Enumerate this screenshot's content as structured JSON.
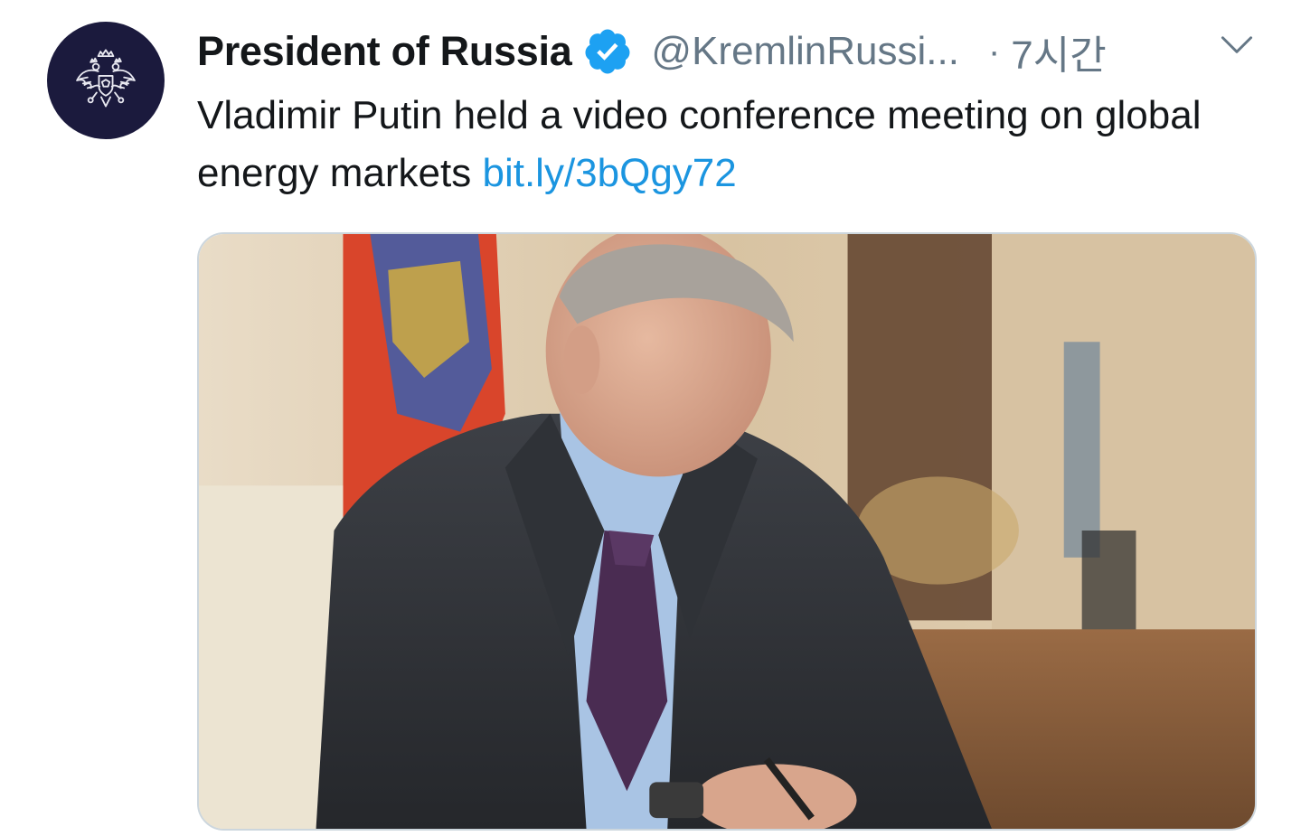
{
  "tweet": {
    "display_name": "President of Russia",
    "handle": "@KremlinRussi...",
    "separator": "·",
    "time": "7시간",
    "text": "Vladimir Putin held a video conference meeting on global energy markets",
    "link": "bit.ly/3bQgy72",
    "avatar_icon": "coat-of-arms-icon",
    "verified_icon": "verified-badge-icon",
    "menu_icon": "chevron-down-icon"
  },
  "colors": {
    "link": "#1b95e0",
    "verified": "#1da1f2",
    "secondary_text": "#657786",
    "avatar_bg": "#1b1a3d"
  }
}
